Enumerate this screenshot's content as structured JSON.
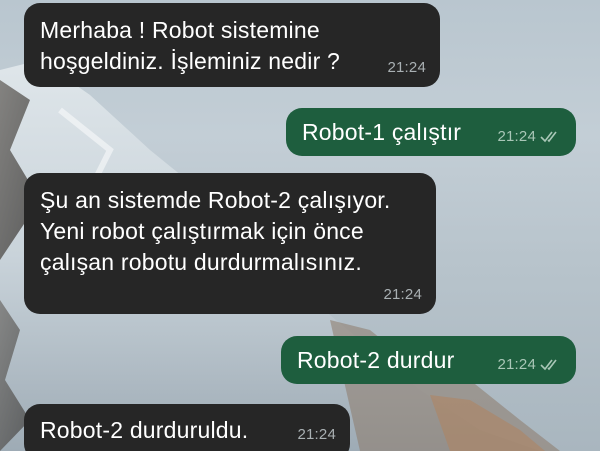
{
  "messages": [
    {
      "side": "incoming",
      "text": "Merhaba ! Robot sistemine\nhoşgeldiniz. İşleminiz nedir ?",
      "time": "21:24"
    },
    {
      "side": "outgoing",
      "text": "Robot-1 çalıştır",
      "time": "21:24",
      "status": "read"
    },
    {
      "side": "incoming",
      "text": "Şu an sistemde Robot-2 çalışıyor.\nYeni robot çalıştırmak için önce\nçalışan robotu durdurmalısınız.",
      "time": "21:24"
    },
    {
      "side": "outgoing",
      "text": "Robot-2 durdur",
      "time": "21:24",
      "status": "read"
    },
    {
      "side": "incoming",
      "text": "Robot-2 durduruldu.",
      "time": "21:24"
    }
  ],
  "colors": {
    "incoming_bubble": "#262626",
    "outgoing_bubble": "#1e5e3e",
    "time_incoming": "#a9b0b3",
    "time_outgoing": "#a9c7b7"
  }
}
